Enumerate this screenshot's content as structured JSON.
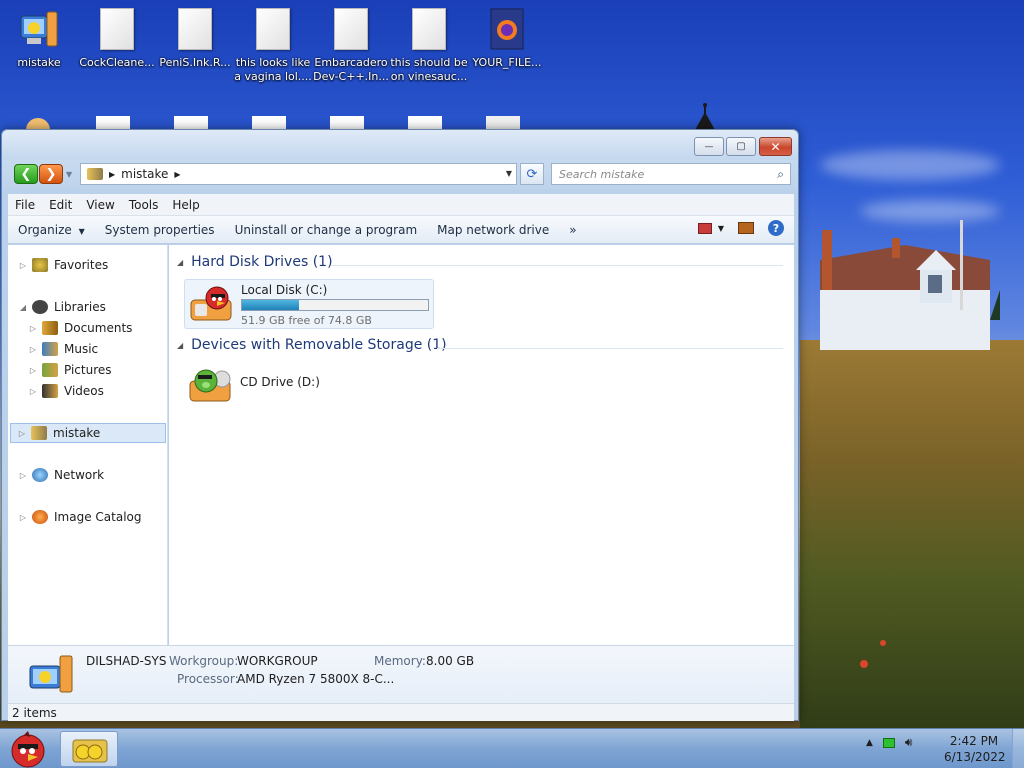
{
  "desktop": {
    "icons": [
      {
        "label": "mistake"
      },
      {
        "label": "CockCleane..."
      },
      {
        "label": "PeniS.Ink.R..."
      },
      {
        "label": "this looks like a vagina lol...."
      },
      {
        "label": "Embarcadero Dev-C++.In..."
      },
      {
        "label": "this should be on vinesauc..."
      },
      {
        "label": "YOUR_FILE..."
      }
    ]
  },
  "window": {
    "title_buttons": {
      "minimize": "—",
      "maximize": "▢",
      "close": "✕"
    },
    "address": {
      "location": "mistake"
    },
    "search": {
      "placeholder": "Search mistake"
    },
    "menu": [
      "File",
      "Edit",
      "View",
      "Tools",
      "Help"
    ],
    "toolbar": {
      "organize": "Organize",
      "system_properties": "System properties",
      "uninstall": "Uninstall or change a program",
      "map_drive": "Map network drive",
      "more": "»"
    },
    "nav": {
      "favorites": "Favorites",
      "libraries": "Libraries",
      "documents": "Documents",
      "music": "Music",
      "pictures": "Pictures",
      "videos": "Videos",
      "mistake": "mistake",
      "network": "Network",
      "image_catalog": "Image Catalog"
    },
    "groups": {
      "hard_disks": "Hard Disk Drives (1)",
      "removable": "Devices with Removable Storage (1)"
    },
    "drives": {
      "c": {
        "name": "Local Disk (C:)",
        "free": "51.9 GB free of 74.8 GB",
        "used_fraction": 0.306
      },
      "d": {
        "name": "CD Drive (D:)"
      }
    },
    "details": {
      "computer_name": "DILSHAD-SYS",
      "workgroup_label": "Workgroup:",
      "workgroup": "WORKGROUP",
      "memory_label": "Memory:",
      "memory": "8.00 GB",
      "processor_label": "Processor:",
      "processor": "AMD Ryzen 7 5800X 8-C..."
    },
    "status": {
      "items": "2 items"
    }
  },
  "taskbar": {
    "time": "2:42 PM",
    "date": "6/13/2022"
  },
  "colors": {
    "accent": "#2f6cc9",
    "capacity_fill": "#1f82b8",
    "close_button": "#c9462c"
  }
}
